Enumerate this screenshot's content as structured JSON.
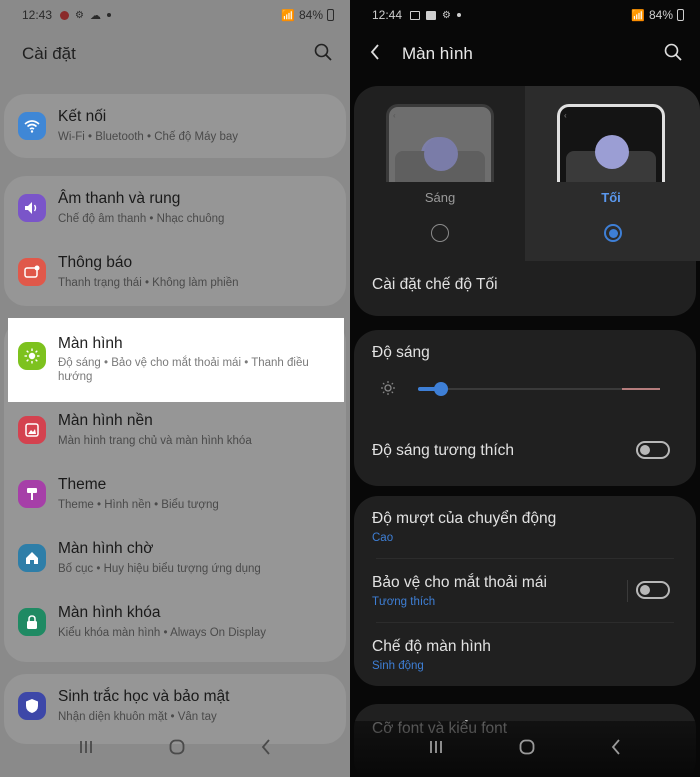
{
  "left": {
    "status": {
      "time": "12:43",
      "battery": "84%"
    },
    "title": "Cài đặt",
    "items": [
      {
        "title": "Kết nối",
        "sub": "Wi-Fi  •  Bluetooth  •  Chế độ Máy bay",
        "icon": "wifi-icon",
        "color": "#3f87d6"
      },
      {
        "title": "Âm thanh và rung",
        "sub": "Chế độ âm thanh  •  Nhạc chuông",
        "icon": "volume-icon",
        "color": "#7a55c9"
      },
      {
        "title": "Thông báo",
        "sub": "Thanh trạng thái  •  Không làm phiền",
        "icon": "notification-icon",
        "color": "#e0584a"
      },
      {
        "title": "Màn hình",
        "sub": "Độ sáng  •  Bảo vệ cho mắt thoải mái  •  Thanh điều hướng",
        "icon": "brightness-icon",
        "color": "#7dc21e"
      },
      {
        "title": "Màn hình nền",
        "sub": "Màn hình trang chủ và màn hình khóa",
        "icon": "wallpaper-icon",
        "color": "#d4424f"
      },
      {
        "title": "Theme",
        "sub": "Theme  •  Hình nền  •  Biểu tượng",
        "icon": "theme-icon",
        "color": "#a63fa8"
      },
      {
        "title": "Màn hình chờ",
        "sub": "Bố cục  •  Huy hiệu biểu tượng ứng dụng",
        "icon": "home-icon",
        "color": "#2e7ea8"
      },
      {
        "title": "Màn hình khóa",
        "sub": "Kiểu khóa màn hình  •  Always On Display",
        "icon": "lock-icon",
        "color": "#1f8a63"
      },
      {
        "title": "Sinh trắc học và bảo mật",
        "sub": "Nhận diện khuôn mặt  •  Vân tay",
        "icon": "shield-icon",
        "color": "#3d47a8"
      }
    ]
  },
  "right": {
    "status": {
      "time": "12:44",
      "battery": "84%"
    },
    "title": "Màn hình",
    "mode_light": "Sáng",
    "mode_dark": "Tối",
    "dark_settings": "Cài đặt chế độ Tối",
    "brightness": "Độ sáng",
    "brightness_level": 0.05,
    "adaptive": "Độ sáng tương thích",
    "motion": "Độ mượt của chuyển động",
    "motion_value": "Cao",
    "eye": "Bảo vệ cho mắt thoải mái",
    "eye_value": "Tương thích",
    "screen_mode": "Chế độ màn hình",
    "screen_mode_value": "Sinh động",
    "font": "Cỡ font và kiểu font"
  },
  "colors": {
    "accent": "#3e7fd6",
    "highlight_bg": "#ffffff"
  }
}
